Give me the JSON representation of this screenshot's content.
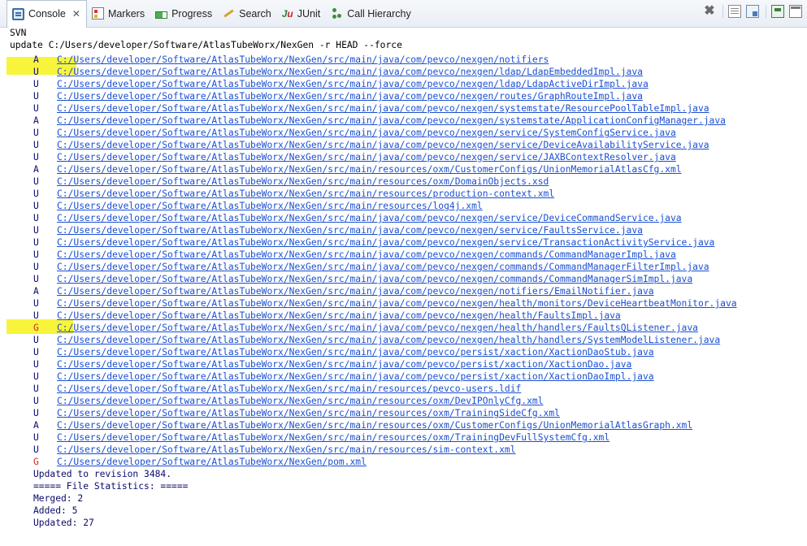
{
  "tabs": [
    {
      "label": "Console",
      "icon": "console-icon",
      "active": true
    },
    {
      "label": "Markers",
      "icon": "markers-icon"
    },
    {
      "label": "Progress",
      "icon": "progress-icon"
    },
    {
      "label": "Search",
      "icon": "search-icon"
    },
    {
      "label": "JUnit",
      "icon": "junit-icon"
    },
    {
      "label": "Call Hierarchy",
      "icon": "call-hierarchy-icon"
    }
  ],
  "console": {
    "title": "SVN",
    "command": "update C:/Users/developer/Software/AtlasTubeWorx/NexGen -r HEAD --force",
    "entries": [
      {
        "status": "A",
        "path": "C:/Users/developer/Software/AtlasTubeWorx/NexGen/src/main/java/com/pevco/nexgen/notifiers"
      },
      {
        "status": "U",
        "path": "C:/Users/developer/Software/AtlasTubeWorx/NexGen/src/main/java/com/pevco/nexgen/ldap/LdapEmbeddedImpl.java"
      },
      {
        "status": "U",
        "path": "C:/Users/developer/Software/AtlasTubeWorx/NexGen/src/main/java/com/pevco/nexgen/ldap/LdapActiveDirImpl.java"
      },
      {
        "status": "U",
        "path": "C:/Users/developer/Software/AtlasTubeWorx/NexGen/src/main/java/com/pevco/nexgen/routes/GraphRouteImpl.java"
      },
      {
        "status": "U",
        "path": "C:/Users/developer/Software/AtlasTubeWorx/NexGen/src/main/java/com/pevco/nexgen/systemstate/ResourcePoolTableImpl.java"
      },
      {
        "status": "A",
        "path": "C:/Users/developer/Software/AtlasTubeWorx/NexGen/src/main/java/com/pevco/nexgen/systemstate/ApplicationConfigManager.java"
      },
      {
        "status": "U",
        "path": "C:/Users/developer/Software/AtlasTubeWorx/NexGen/src/main/java/com/pevco/nexgen/service/SystemConfigService.java"
      },
      {
        "status": "U",
        "path": "C:/Users/developer/Software/AtlasTubeWorx/NexGen/src/main/java/com/pevco/nexgen/service/DeviceAvailabilityService.java"
      },
      {
        "status": "U",
        "path": "C:/Users/developer/Software/AtlasTubeWorx/NexGen/src/main/java/com/pevco/nexgen/service/JAXBContextResolver.java"
      },
      {
        "status": "A",
        "path": "C:/Users/developer/Software/AtlasTubeWorx/NexGen/src/main/resources/oxm/CustomerConfigs/UnionMemorialAtlasCfg.xml"
      },
      {
        "status": "U",
        "path": "C:/Users/developer/Software/AtlasTubeWorx/NexGen/src/main/resources/oxm/DomainObjects.xsd"
      },
      {
        "status": "U",
        "path": "C:/Users/developer/Software/AtlasTubeWorx/NexGen/src/main/resources/production-context.xml"
      },
      {
        "status": "U",
        "path": "C:/Users/developer/Software/AtlasTubeWorx/NexGen/src/main/resources/log4j.xml"
      },
      {
        "status": "U",
        "path": "C:/Users/developer/Software/AtlasTubeWorx/NexGen/src/main/java/com/pevco/nexgen/service/DeviceCommandService.java"
      },
      {
        "status": "U",
        "path": "C:/Users/developer/Software/AtlasTubeWorx/NexGen/src/main/java/com/pevco/nexgen/service/FaultsService.java"
      },
      {
        "status": "U",
        "path": "C:/Users/developer/Software/AtlasTubeWorx/NexGen/src/main/java/com/pevco/nexgen/service/TransactionActivityService.java"
      },
      {
        "status": "U",
        "path": "C:/Users/developer/Software/AtlasTubeWorx/NexGen/src/main/java/com/pevco/nexgen/commands/CommandManagerImpl.java"
      },
      {
        "status": "U",
        "path": "C:/Users/developer/Software/AtlasTubeWorx/NexGen/src/main/java/com/pevco/nexgen/commands/CommandManagerFilterImpl.java"
      },
      {
        "status": "U",
        "path": "C:/Users/developer/Software/AtlasTubeWorx/NexGen/src/main/java/com/pevco/nexgen/commands/CommandManagerSimImpl.java"
      },
      {
        "status": "A",
        "path": "C:/Users/developer/Software/AtlasTubeWorx/NexGen/src/main/java/com/pevco/nexgen/notifiers/EmailNotifier.java"
      },
      {
        "status": "U",
        "path": "C:/Users/developer/Software/AtlasTubeWorx/NexGen/src/main/java/com/pevco/nexgen/health/monitors/DeviceHeartbeatMonitor.java"
      },
      {
        "status": "U",
        "path": "C:/Users/developer/Software/AtlasTubeWorx/NexGen/src/main/java/com/pevco/nexgen/health/FaultsImpl.java"
      },
      {
        "status": "G",
        "path": "C:/Users/developer/Software/AtlasTubeWorx/NexGen/src/main/java/com/pevco/nexgen/health/handlers/FaultsQListener.java"
      },
      {
        "status": "U",
        "path": "C:/Users/developer/Software/AtlasTubeWorx/NexGen/src/main/java/com/pevco/nexgen/health/handlers/SystemModelListener.java"
      },
      {
        "status": "U",
        "path": "C:/Users/developer/Software/AtlasTubeWorx/NexGen/src/main/java/com/pevco/persist/xaction/XactionDaoStub.java"
      },
      {
        "status": "U",
        "path": "C:/Users/developer/Software/AtlasTubeWorx/NexGen/src/main/java/com/pevco/persist/xaction/XactionDao.java"
      },
      {
        "status": "U",
        "path": "C:/Users/developer/Software/AtlasTubeWorx/NexGen/src/main/java/com/pevco/persist/xaction/XactionDaoImpl.java"
      },
      {
        "status": "U",
        "path": "C:/Users/developer/Software/AtlasTubeWorx/NexGen/src/main/resources/pevco-users.ldif"
      },
      {
        "status": "U",
        "path": "C:/Users/developer/Software/AtlasTubeWorx/NexGen/src/main/resources/oxm/DevIPOnlyCfg.xml"
      },
      {
        "status": "U",
        "path": "C:/Users/developer/Software/AtlasTubeWorx/NexGen/src/main/resources/oxm/TrainingSideCfg.xml"
      },
      {
        "status": "A",
        "path": "C:/Users/developer/Software/AtlasTubeWorx/NexGen/src/main/resources/oxm/CustomerConfigs/UnionMemorialAtlasGraph.xml"
      },
      {
        "status": "U",
        "path": "C:/Users/developer/Software/AtlasTubeWorx/NexGen/src/main/resources/oxm/TrainingDevFullSystemCfg.xml"
      },
      {
        "status": "U",
        "path": "C:/Users/developer/Software/AtlasTubeWorx/NexGen/src/main/resources/sim-context.xml"
      },
      {
        "status": "G",
        "path": "C:/Users/developer/Software/AtlasTubeWorx/NexGen/pom.xml"
      }
    ],
    "summary": [
      "Updated to revision 3484.",
      "===== File Statistics: =====",
      "Merged: 2",
      "Added: 5",
      "Updated: 27"
    ]
  },
  "colors": {
    "highlight": "#f8f43c",
    "merged_status": "#dd2222",
    "link": "#1a4fd1"
  }
}
